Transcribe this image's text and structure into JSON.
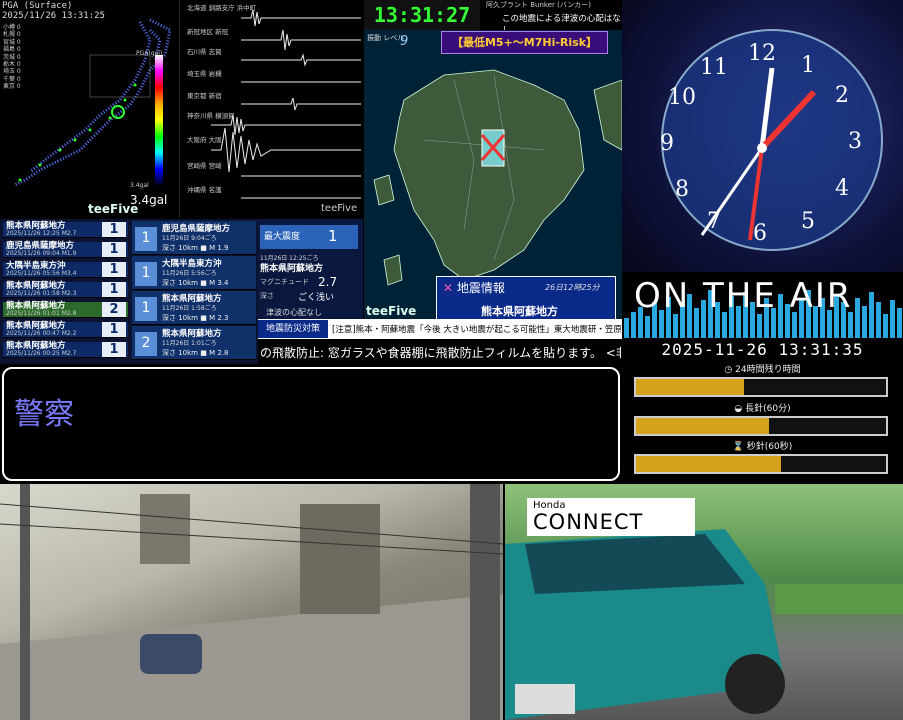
{
  "pga": {
    "header_line1": "PGA (Surface)",
    "header_line2": "2025/11/26 13:31:25",
    "legend": [
      "小樽 0",
      "札幌 0",
      "宮城 0",
      "福島 0",
      "茨城 0",
      "栃木 0",
      "埼玉 0",
      "千葉 0",
      "東京 0"
    ],
    "scale_label": "PGA(gal)",
    "peak_label": "3.4gal",
    "peak_value": "3.4gal",
    "brand": "teeFive"
  },
  "waveforms": {
    "stations": [
      "北海道 釧路支庁 浜中町",
      "新冠地区 新冠",
      "石川県 志賀",
      "埼玉県 岩槻",
      "東京都 新宿",
      "神奈川県 横須賀",
      "大阪府 大阪",
      "宮崎県 宮崎",
      "沖縄県 名護"
    ],
    "brand": "teeFive"
  },
  "eq_list": [
    {
      "place": "熊本県阿蘇地方",
      "time": "2025/11/26 12:25",
      "mag": "M2.7",
      "intensity": "1"
    },
    {
      "place": "鹿児島県薩摩地方",
      "time": "2025/11/26 09:04",
      "mag": "M1.9",
      "intensity": "1"
    },
    {
      "place": "大隅半島東方沖",
      "time": "2025/11/26 05:56",
      "mag": "M3.4",
      "intensity": "1"
    },
    {
      "place": "熊本県阿蘇地方",
      "time": "2025/11/26 01:58",
      "mag": "M2.3",
      "intensity": "1"
    },
    {
      "place": "熊本県阿蘇地方",
      "time": "2025/11/26 01:01",
      "mag": "M2.8",
      "intensity": "2"
    },
    {
      "place": "熊本県阿蘇地方",
      "time": "2025/11/26 00:47",
      "mag": "M2.2",
      "intensity": "1"
    },
    {
      "place": "熊本県阿蘇地方",
      "time": "2025/11/26 00:25",
      "mag": "M2.7",
      "intensity": "1"
    }
  ],
  "eq_cards": [
    {
      "num": "1",
      "place": "鹿児島県薩摩地方",
      "time": "11月26日 9:04ごろ",
      "dm": "深さ 10km ■ M 1.9"
    },
    {
      "num": "1",
      "place": "大隅半島東方沖",
      "time": "11月26日 5:56ごろ",
      "dm": "深さ 10km ■ M 3.4"
    },
    {
      "num": "1",
      "place": "熊本県阿蘇地方",
      "time": "11月26日 1:58ごろ",
      "dm": "深さ 10km ■ M 2.3"
    },
    {
      "num": "2",
      "place": "熊本県阿蘇地方",
      "time": "11月26日 1:01ごろ",
      "dm": "深さ 10km ■ M 2.8"
    }
  ],
  "center_info": {
    "max_label": "最大震度",
    "max_value": "1",
    "time": "11月26日 12:25ごろ",
    "place": "熊本県阿蘇地方",
    "mag_label": "マグニチュード",
    "mag_value": "2.7",
    "depth_label": "深さ",
    "depth_value": "ごく浅い",
    "tsunami": "津波の心配なし"
  },
  "clock": "13:31:27",
  "bunker": {
    "title": "阿久ブラント Bunker (バンカー)",
    "message": "この地震による津波の心配はなし"
  },
  "quake_map": {
    "level_label": "振動 レベル",
    "level_value": "9",
    "warning": "【最低M5+〜M7Hi-Risk】",
    "brand": "teeFive"
  },
  "quake_info": {
    "heading": "地震情報",
    "datetime": "26日12時25分",
    "place": "熊本県阿蘇地方"
  },
  "ticker1": {
    "tag": "地震防災対策",
    "text": "[注意]熊本・阿蘇地震「今後 大きい地震が起こる可能性」東大地震研・笠原教授"
  },
  "ticker2": {
    "text": "の飛散防止: 窓ガラスや食器棚に飛散防止フィルムを貼ります。 <非"
  },
  "police": {
    "text": "警察"
  },
  "analog": {
    "numbers": [
      "12",
      "1",
      "2",
      "3",
      "4",
      "5",
      "6",
      "7",
      "8",
      "9",
      "10",
      "11"
    ]
  },
  "on_air": "ON THE AIR",
  "datetime": "2025-11-26 13:31:35",
  "bars": [
    {
      "label": "24時間残り時間",
      "fraction": 0.43
    },
    {
      "label": "長針(60分)",
      "fraction": 0.53
    },
    {
      "label": "秒針(60秒)",
      "fraction": 0.58
    }
  ],
  "camera2": {
    "logo_small": "Honda",
    "logo_big": "CONNECT"
  }
}
